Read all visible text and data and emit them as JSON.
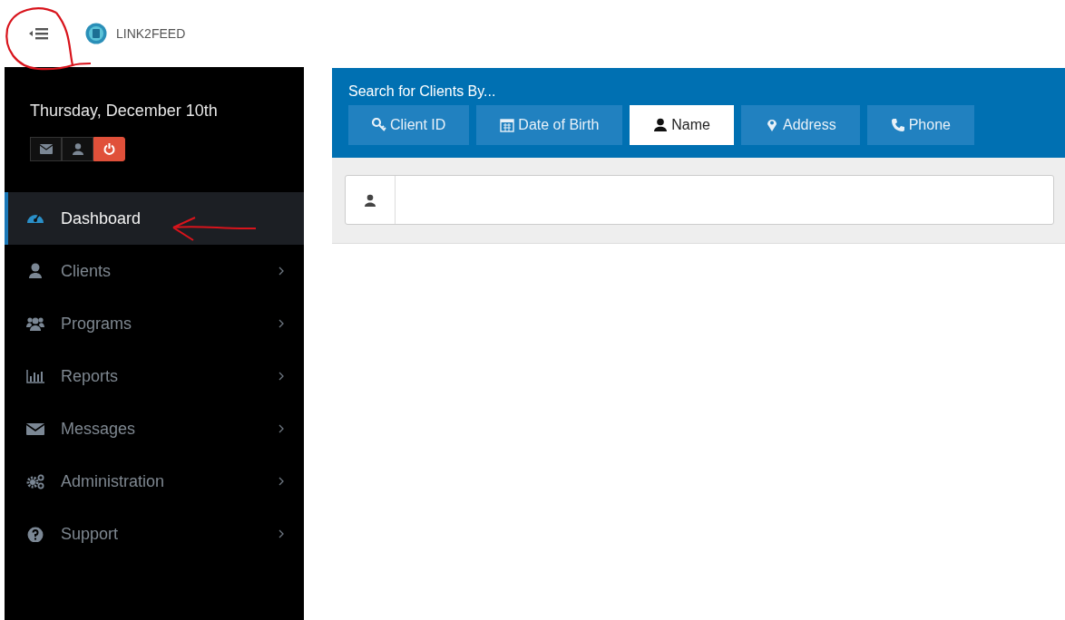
{
  "header": {
    "logo_text": "LINK2FEED"
  },
  "sidebar": {
    "date": "Thursday, December 10th",
    "quick_buttons": [
      {
        "kind": "messages"
      },
      {
        "kind": "profile"
      },
      {
        "kind": "logout"
      }
    ],
    "items": [
      {
        "label": "Dashboard",
        "selected": true,
        "has_submenu": false
      },
      {
        "label": "Clients",
        "selected": false,
        "has_submenu": true
      },
      {
        "label": "Programs",
        "selected": false,
        "has_submenu": true
      },
      {
        "label": "Reports",
        "selected": false,
        "has_submenu": true
      },
      {
        "label": "Messages",
        "selected": false,
        "has_submenu": true
      },
      {
        "label": "Administration",
        "selected": false,
        "has_submenu": true
      },
      {
        "label": "Support",
        "selected": false,
        "has_submenu": true
      }
    ]
  },
  "search_panel": {
    "title": "Search for Clients By...",
    "tabs": [
      {
        "label": "Client ID",
        "selected": false
      },
      {
        "label": "Date of Birth",
        "selected": false
      },
      {
        "label": "Name",
        "selected": true
      },
      {
        "label": "Address",
        "selected": false
      },
      {
        "label": "Phone",
        "selected": false
      }
    ]
  },
  "annotations": [
    {
      "kind": "circle"
    },
    {
      "kind": "arrow"
    }
  ]
}
